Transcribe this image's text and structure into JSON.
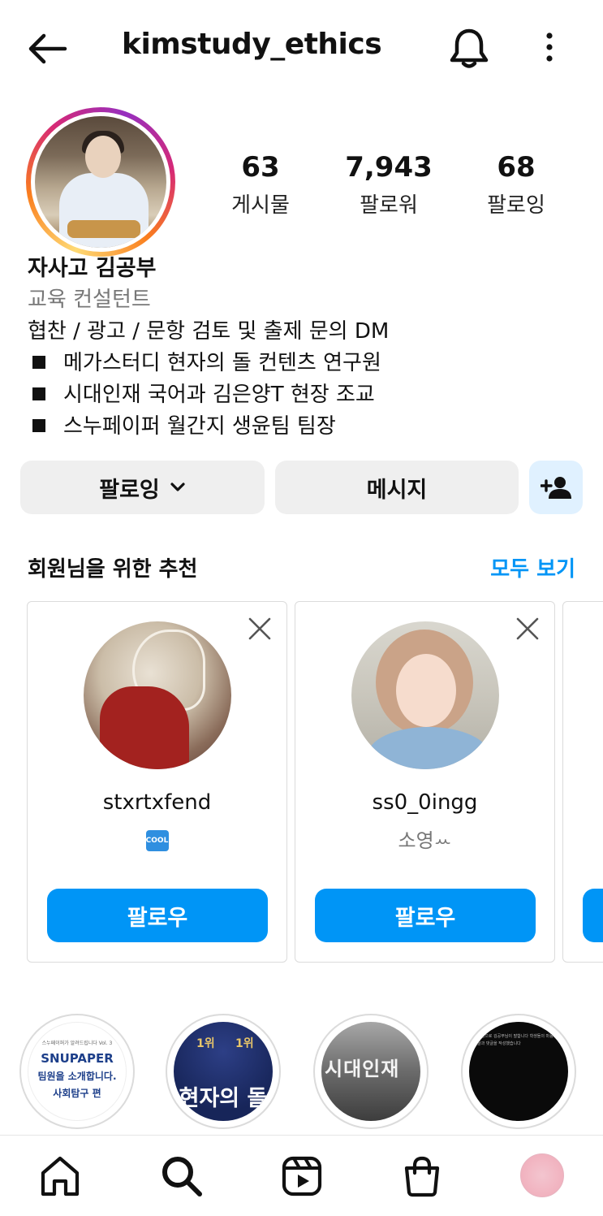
{
  "header": {
    "username": "kimstudy_ethics",
    "back_icon": "arrow-left-icon",
    "notification_icon": "bell-icon",
    "more_icon": "more-vertical-icon"
  },
  "profile": {
    "stats": [
      {
        "value": "63",
        "label": "게시물"
      },
      {
        "value": "7,943",
        "label": "팔로워"
      },
      {
        "value": "68",
        "label": "팔로잉"
      }
    ],
    "name": "자사고 김공부",
    "category": "교육 컨설턴트",
    "bio_line1": "협찬 / 광고 / 문항 검토 및 출제 문의 DM",
    "bio_bullets": [
      "메가스터디 현자의 돌 컨텐츠 연구원",
      "시대인재 국어과 김은양T 현장 조교",
      "스누페이퍼 월간지 생윤팀 팀장"
    ]
  },
  "actions": {
    "following_label": "팔로잉",
    "message_label": "메시지",
    "add_user_icon": "person-add-icon"
  },
  "suggestions": {
    "title": "회원님을 위한 추천",
    "see_all": "모두 보기",
    "cards": [
      {
        "handle": "stxrtxfend",
        "subtitle": "COOL",
        "follow_label": "팔로우"
      },
      {
        "handle": "ss0_0ingg",
        "subtitle": "소영ꕀ",
        "follow_label": "팔로우"
      },
      {
        "handle": "",
        "subtitle": "",
        "follow_label": ""
      }
    ]
  },
  "highlights": [
    {
      "tiny": "스누페이퍼가 알려드립니다 Vol. 3",
      "brand": "SNUPAPER",
      "line2": "팀원을 소개합니다.",
      "line3": "사회탐구 편"
    },
    {
      "rank1": "1위",
      "rank2": "1위",
      "big": "현자의 돌"
    },
    {
      "sign": "시대인재"
    },
    {
      "text": "학생으로 김공부님이 말합니다 학생들의 마음으로 글과 댓글을 작성했습니다"
    }
  ],
  "colors": {
    "accent_blue": "#0095f6",
    "button_gray": "#efefef",
    "add_user_bg": "#e0f1ff"
  }
}
